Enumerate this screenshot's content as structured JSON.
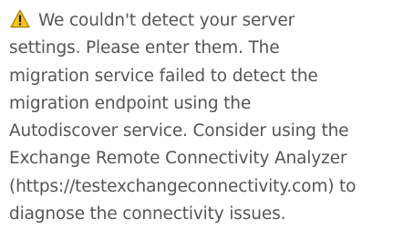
{
  "icon": "warning-icon",
  "colors": {
    "text": "#555555",
    "warning_fill": "#f5c518",
    "warning_stroke": "#a37d00"
  },
  "message": {
    "lines": [
      "We couldn't detect your server",
      "settings. Please enter them. The",
      "migration service failed to detect the",
      "migration endpoint using the",
      "Autodiscover service. Consider using the",
      "Exchange Remote Connectivity Analyzer",
      "(https://testexchangeconnectivity.com) to",
      "diagnose the connectivity issues."
    ]
  }
}
